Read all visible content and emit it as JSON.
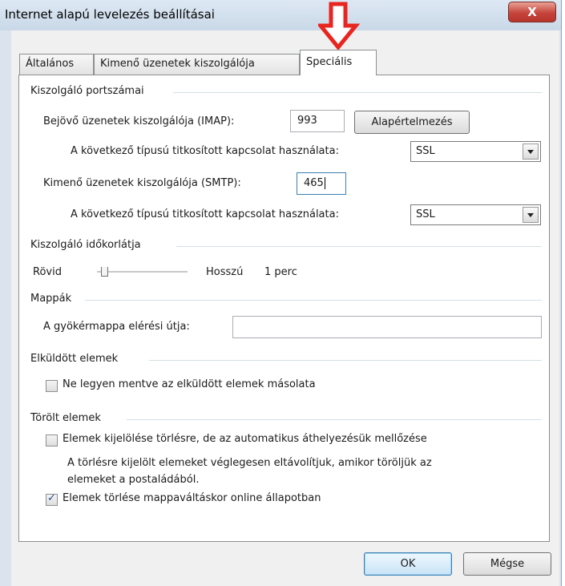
{
  "window": {
    "title": "Internet alapú levelezés beállításai",
    "close_glyph": "X"
  },
  "tabs": [
    {
      "label": "Általános"
    },
    {
      "label": "Kimenő üzenetek kiszolgálója"
    },
    {
      "label": "Speciális",
      "selected": true
    }
  ],
  "ports": {
    "group_label": "Kiszolgáló portszámai",
    "incoming_label": "Bejövő üzenetek kiszolgálója (IMAP):",
    "incoming_value": "993",
    "default_button": "Alapértelmezés",
    "incoming_encryption_label": "A következő típusú titkosított kapcsolat használata:",
    "incoming_encryption_value": "SSL",
    "outgoing_label": "Kimenő üzenetek kiszolgálója (SMTP):",
    "outgoing_value": "465",
    "outgoing_encryption_label": "A következő típusú titkosított kapcsolat használata:",
    "outgoing_encryption_value": "SSL"
  },
  "timeout": {
    "group_label": "Kiszolgáló időkorlátja",
    "short_label": "Rövid",
    "long_label": "Hosszú",
    "value_text": "1 perc",
    "slider_position_fraction": 0.08
  },
  "folders": {
    "group_label": "Mappák",
    "root_path_label": "A gyökérmappa elérési útja:",
    "root_path_value": ""
  },
  "sent_items": {
    "group_label": "Elküldött elemek",
    "no_copy_label": "Ne legyen mentve az elküldött elemek másolata",
    "no_copy_checked": false
  },
  "deleted_items": {
    "group_label": "Törölt elemek",
    "mark_label": "Elemek kijelölése törlésre, de az automatikus áthelyezésük mellőzése",
    "mark_checked": false,
    "note_line1": "A törlésre kijelölt elemeket véglegesen eltávolítjuk, amikor töröljük az",
    "note_line2": "elemeket a postaládából.",
    "purge_label": "Elemek törlése mappaváltáskor online állapotban",
    "purge_checked": true
  },
  "footer": {
    "ok_label": "OK",
    "cancel_label": "Mégse"
  },
  "colors": {
    "annotation_arrow": "#e8251f",
    "close_button": "#c5443b"
  }
}
